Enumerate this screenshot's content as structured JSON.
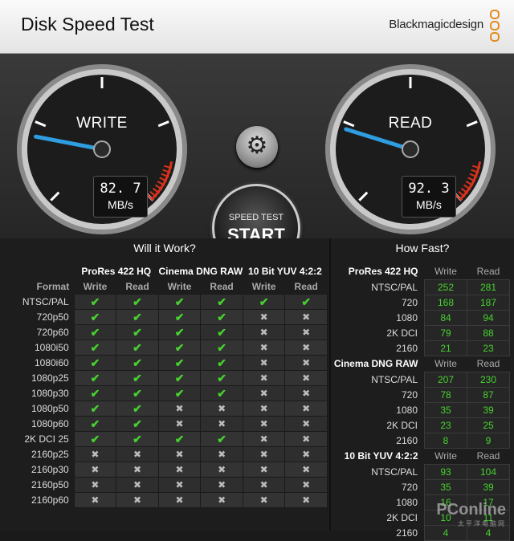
{
  "app": {
    "title": "Disk Speed Test",
    "brand": "Blackmagicdesign"
  },
  "gauges": {
    "write": {
      "title": "WRITE",
      "value": "82. 7",
      "unit": "MB/s"
    },
    "read": {
      "title": "READ",
      "value": "92. 3",
      "unit": "MB/s"
    }
  },
  "controls": {
    "start_line1": "SPEED TEST",
    "start_line2": "START",
    "settings_icon": "gear-icon"
  },
  "sections": {
    "will_it_work": "Will it Work?",
    "how_fast": "How Fast?"
  },
  "will_it_work": {
    "format_label": "Format",
    "groups": [
      "ProRes 422 HQ",
      "Cinema DNG RAW",
      "10 Bit YUV 4:2:2"
    ],
    "sub": [
      "Write",
      "Read",
      "Write",
      "Read",
      "Write",
      "Read"
    ],
    "rows": [
      {
        "format": "NTSC/PAL",
        "cells": [
          1,
          1,
          1,
          1,
          1,
          1
        ]
      },
      {
        "format": "720p50",
        "cells": [
          1,
          1,
          1,
          1,
          0,
          0
        ]
      },
      {
        "format": "720p60",
        "cells": [
          1,
          1,
          1,
          1,
          0,
          0
        ]
      },
      {
        "format": "1080i50",
        "cells": [
          1,
          1,
          1,
          1,
          0,
          0
        ]
      },
      {
        "format": "1080i60",
        "cells": [
          1,
          1,
          1,
          1,
          0,
          0
        ]
      },
      {
        "format": "1080p25",
        "cells": [
          1,
          1,
          1,
          1,
          0,
          0
        ]
      },
      {
        "format": "1080p30",
        "cells": [
          1,
          1,
          1,
          1,
          0,
          0
        ]
      },
      {
        "format": "1080p50",
        "cells": [
          1,
          1,
          0,
          0,
          0,
          0
        ]
      },
      {
        "format": "1080p60",
        "cells": [
          1,
          1,
          0,
          0,
          0,
          0
        ]
      },
      {
        "format": "2K DCI 25",
        "cells": [
          1,
          1,
          1,
          1,
          0,
          0
        ]
      },
      {
        "format": "2160p25",
        "cells": [
          0,
          0,
          0,
          0,
          0,
          0
        ]
      },
      {
        "format": "2160p30",
        "cells": [
          0,
          0,
          0,
          0,
          0,
          0
        ]
      },
      {
        "format": "2160p50",
        "cells": [
          0,
          0,
          0,
          0,
          0,
          0
        ]
      },
      {
        "format": "2160p60",
        "cells": [
          0,
          0,
          0,
          0,
          0,
          0
        ]
      }
    ]
  },
  "how_fast": {
    "sub": [
      "Write",
      "Read"
    ],
    "groups": [
      {
        "name": "ProRes 422 HQ",
        "rows": [
          {
            "format": "NTSC/PAL",
            "write": "252",
            "read": "281"
          },
          {
            "format": "720",
            "write": "168",
            "read": "187"
          },
          {
            "format": "1080",
            "write": "84",
            "read": "94"
          },
          {
            "format": "2K DCI",
            "write": "79",
            "read": "88"
          },
          {
            "format": "2160",
            "write": "21",
            "read": "23"
          }
        ]
      },
      {
        "name": "Cinema DNG RAW",
        "rows": [
          {
            "format": "NTSC/PAL",
            "write": "207",
            "read": "230"
          },
          {
            "format": "720",
            "write": "78",
            "read": "87"
          },
          {
            "format": "1080",
            "write": "35",
            "read": "39"
          },
          {
            "format": "2K DCI",
            "write": "23",
            "read": "25"
          },
          {
            "format": "2160",
            "write": "8",
            "read": "9"
          }
        ]
      },
      {
        "name": "10 Bit YUV 4:2:2",
        "rows": [
          {
            "format": "NTSC/PAL",
            "write": "93",
            "read": "104"
          },
          {
            "format": "720",
            "write": "35",
            "read": "39"
          },
          {
            "format": "1080",
            "write": "16",
            "read": "17"
          },
          {
            "format": "2K DCI",
            "write": "10",
            "read": "11"
          },
          {
            "format": "2160",
            "write": "4",
            "read": "4"
          }
        ]
      }
    ]
  },
  "watermark": {
    "text": "PConline",
    "sub": "太平洋电脑网"
  },
  "colors": {
    "accent_green": "#47d12f",
    "needle_blue": "#2f9de0",
    "redline": "#d8321c",
    "brand_orange": "#e38a1d"
  }
}
